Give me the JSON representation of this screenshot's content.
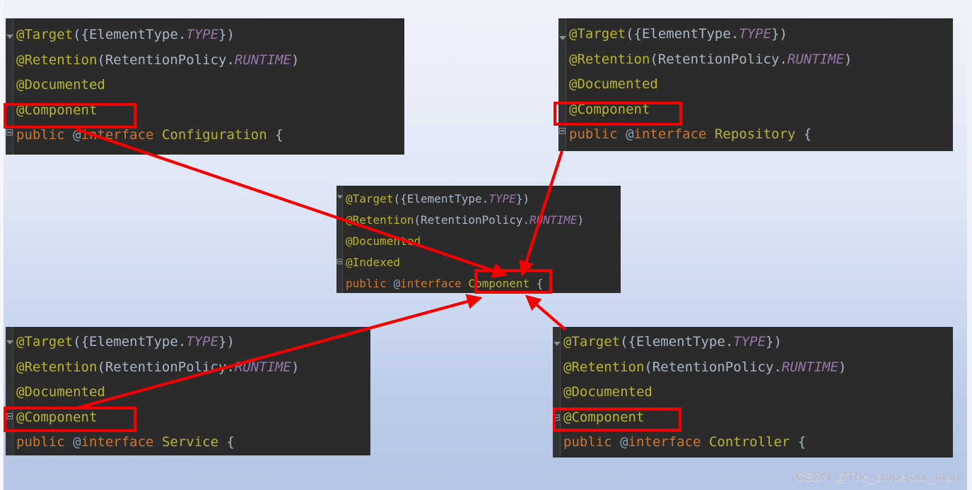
{
  "background": {
    "gradient_top": "#eef2fb",
    "gradient_bottom": "#b5c6e6",
    "panel_bg": "#2b2b2b",
    "gutter_bg": "#313335",
    "highlight_color": "#f40000",
    "arrow_color": "#f40000"
  },
  "syntax_colors": {
    "annotation": "#bbb529",
    "punctuation": "#a9b7c6",
    "identifier": "#a9b7c6",
    "static_field": "#9876aa",
    "keyword": "#cc7832",
    "at_symbol": "#8aa0b4",
    "class_name": "#b5b33a"
  },
  "panels": [
    {
      "id": "configuration",
      "name": "Configuration annotation source",
      "lines": [
        {
          "tokens": [
            {
              "t": "@Target",
              "c": "anno"
            },
            {
              "t": "({",
              "c": "punct"
            },
            {
              "t": "ElementType",
              "c": "ident"
            },
            {
              "t": ".",
              "c": "punct"
            },
            {
              "t": "TYPE",
              "c": "static"
            },
            {
              "t": "})",
              "c": "punct"
            }
          ]
        },
        {
          "tokens": [
            {
              "t": "@Retention",
              "c": "anno"
            },
            {
              "t": "(",
              "c": "punct"
            },
            {
              "t": "RetentionPolicy",
              "c": "ident"
            },
            {
              "t": ".",
              "c": "punct"
            },
            {
              "t": "RUNTIME",
              "c": "static"
            },
            {
              "t": ")",
              "c": "punct"
            }
          ]
        },
        {
          "tokens": [
            {
              "t": "@Documented",
              "c": "anno"
            }
          ]
        },
        {
          "tokens": [
            {
              "t": "@Component",
              "c": "anno"
            }
          ]
        },
        {
          "tokens": [
            {
              "t": "public ",
              "c": "kw"
            },
            {
              "t": "@",
              "c": "at"
            },
            {
              "t": "interface",
              "c": "kw"
            },
            {
              "t": " ",
              "c": "punct"
            },
            {
              "t": "Configuration",
              "c": "class"
            },
            {
              "t": " {",
              "c": "punct"
            }
          ]
        }
      ]
    },
    {
      "id": "repository",
      "name": "Repository annotation source",
      "lines": [
        {
          "tokens": [
            {
              "t": "@Target",
              "c": "anno"
            },
            {
              "t": "({",
              "c": "punct"
            },
            {
              "t": "ElementType",
              "c": "ident"
            },
            {
              "t": ".",
              "c": "punct"
            },
            {
              "t": "TYPE",
              "c": "static"
            },
            {
              "t": "})",
              "c": "punct"
            }
          ]
        },
        {
          "tokens": [
            {
              "t": "@Retention",
              "c": "anno"
            },
            {
              "t": "(",
              "c": "punct"
            },
            {
              "t": "RetentionPolicy",
              "c": "ident"
            },
            {
              "t": ".",
              "c": "punct"
            },
            {
              "t": "RUNTIME",
              "c": "static"
            },
            {
              "t": ")",
              "c": "punct"
            }
          ]
        },
        {
          "tokens": [
            {
              "t": "@Documented",
              "c": "anno"
            }
          ]
        },
        {
          "tokens": [
            {
              "t": "@Component",
              "c": "anno"
            }
          ]
        },
        {
          "tokens": [
            {
              "t": "public ",
              "c": "kw"
            },
            {
              "t": "@",
              "c": "at"
            },
            {
              "t": "interface",
              "c": "kw"
            },
            {
              "t": " ",
              "c": "punct"
            },
            {
              "t": "Repository",
              "c": "class"
            },
            {
              "t": " {",
              "c": "punct"
            }
          ]
        }
      ]
    },
    {
      "id": "component",
      "name": "Component annotation source",
      "lines": [
        {
          "tokens": [
            {
              "t": "@Target",
              "c": "anno"
            },
            {
              "t": "({",
              "c": "punct"
            },
            {
              "t": "ElementType",
              "c": "ident"
            },
            {
              "t": ".",
              "c": "punct"
            },
            {
              "t": "TYPE",
              "c": "static"
            },
            {
              "t": "})",
              "c": "punct"
            }
          ]
        },
        {
          "tokens": [
            {
              "t": "@Retention",
              "c": "anno"
            },
            {
              "t": "(",
              "c": "punct"
            },
            {
              "t": "RetentionPolicy",
              "c": "ident"
            },
            {
              "t": ".",
              "c": "punct"
            },
            {
              "t": "RUNTIME",
              "c": "static"
            },
            {
              "t": ")",
              "c": "punct"
            }
          ]
        },
        {
          "tokens": [
            {
              "t": "@Documented",
              "c": "anno"
            }
          ]
        },
        {
          "tokens": [
            {
              "t": "@Indexed",
              "c": "anno"
            }
          ]
        },
        {
          "tokens": [
            {
              "t": "public ",
              "c": "kw"
            },
            {
              "t": "@",
              "c": "at"
            },
            {
              "t": "interface",
              "c": "kw"
            },
            {
              "t": " ",
              "c": "punct"
            },
            {
              "t": "Component",
              "c": "class"
            },
            {
              "t": " {",
              "c": "punct"
            }
          ]
        }
      ]
    },
    {
      "id": "service",
      "name": "Service annotation source",
      "lines": [
        {
          "tokens": [
            {
              "t": "@Target",
              "c": "anno"
            },
            {
              "t": "({",
              "c": "punct"
            },
            {
              "t": "ElementType",
              "c": "ident"
            },
            {
              "t": ".",
              "c": "punct"
            },
            {
              "t": "TYPE",
              "c": "static"
            },
            {
              "t": "})",
              "c": "punct"
            }
          ]
        },
        {
          "tokens": [
            {
              "t": "@Retention",
              "c": "anno"
            },
            {
              "t": "(",
              "c": "punct"
            },
            {
              "t": "RetentionPolicy",
              "c": "ident"
            },
            {
              "t": ".",
              "c": "punct"
            },
            {
              "t": "RUNTIME",
              "c": "static"
            },
            {
              "t": ")",
              "c": "punct"
            }
          ]
        },
        {
          "tokens": [
            {
              "t": "@Documented",
              "c": "anno"
            }
          ]
        },
        {
          "tokens": [
            {
              "t": "@Component",
              "c": "anno"
            }
          ]
        },
        {
          "tokens": [
            {
              "t": "public ",
              "c": "kw"
            },
            {
              "t": "@",
              "c": "at"
            },
            {
              "t": "interface",
              "c": "kw"
            },
            {
              "t": " ",
              "c": "punct"
            },
            {
              "t": "Service",
              "c": "class"
            },
            {
              "t": " {",
              "c": "punct"
            }
          ]
        }
      ]
    },
    {
      "id": "controller",
      "name": "Controller annotation source",
      "lines": [
        {
          "tokens": [
            {
              "t": "@Target",
              "c": "anno"
            },
            {
              "t": "({",
              "c": "punct"
            },
            {
              "t": "ElementType",
              "c": "ident"
            },
            {
              "t": ".",
              "c": "punct"
            },
            {
              "t": "TYPE",
              "c": "static"
            },
            {
              "t": "})",
              "c": "punct"
            }
          ]
        },
        {
          "tokens": [
            {
              "t": "@Retention",
              "c": "anno"
            },
            {
              "t": "(",
              "c": "punct"
            },
            {
              "t": "RetentionPolicy",
              "c": "ident"
            },
            {
              "t": ".",
              "c": "punct"
            },
            {
              "t": "RUNTIME",
              "c": "static"
            },
            {
              "t": ")",
              "c": "punct"
            }
          ]
        },
        {
          "tokens": [
            {
              "t": "@Documented",
              "c": "anno"
            }
          ]
        },
        {
          "tokens": [
            {
              "t": "@Component",
              "c": "anno"
            }
          ]
        },
        {
          "tokens": [
            {
              "t": "public ",
              "c": "kw"
            },
            {
              "t": "@",
              "c": "at"
            },
            {
              "t": "interface",
              "c": "kw"
            },
            {
              "t": " ",
              "c": "punct"
            },
            {
              "t": "Controller",
              "c": "class"
            },
            {
              "t": " {",
              "c": "punct"
            }
          ]
        }
      ]
    }
  ],
  "watermark": {
    "text": "CSDN @The_emperoor_man"
  }
}
